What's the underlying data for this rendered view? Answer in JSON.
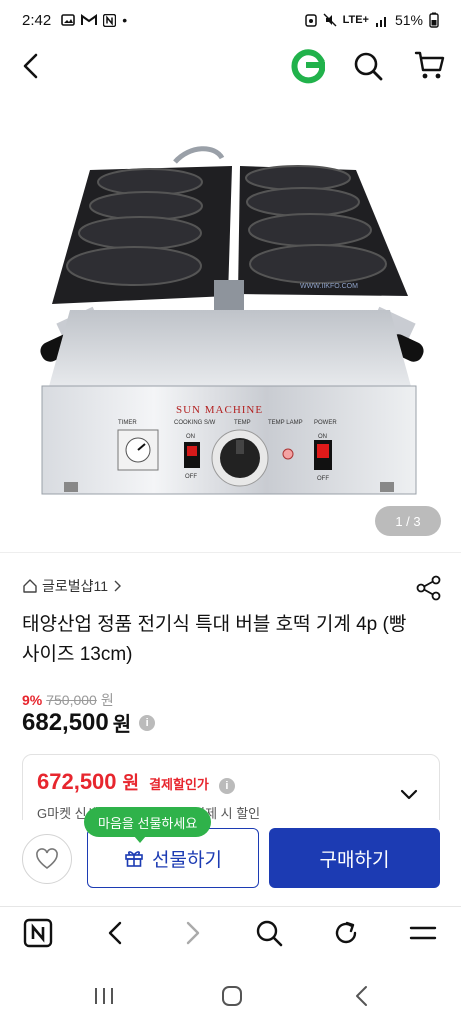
{
  "status_bar": {
    "time": "2:42",
    "network": "LTE+",
    "battery": "51%"
  },
  "header": {
    "icons": [
      "back-icon",
      "g-logo-icon",
      "search-icon",
      "cart-icon"
    ],
    "brand_color": "#21b24b"
  },
  "gallery": {
    "indicator": "1 / 3",
    "machine_brand": "SUN  MACHINE",
    "panel_labels": {
      "timer": "TIMER",
      "cooking": "COOKING S/W",
      "temp": "TEMP",
      "temp_lamp": "TEMP LAMP",
      "power": "POWER",
      "on": "ON",
      "off": "OFF"
    },
    "watermark": "WWW.IIKFO.COM"
  },
  "product": {
    "seller": "글로벌샵11",
    "title": "태양산업 정품 전기식 특대 버블 호떡 기계 4p (빵사이즈 13cm)",
    "discount_rate": "9%",
    "original_price": "750,000",
    "original_unit": "원",
    "price": "682,500",
    "price_unit": "원",
    "info_glyph": "i"
  },
  "coupon": {
    "amount": "672,500",
    "unit": "원",
    "label": "결제할인가",
    "info_glyph": "i",
    "sub": "G마켓 신세계 유니버스 회원 결제 시 할인"
  },
  "actions": {
    "gift_tooltip": "마음을 선물하세요",
    "gift_label": "선물하기",
    "buy_label": "구매하기",
    "accent_color": "#1c3bb3",
    "tooltip_color": "#2fb24a"
  },
  "browser": {
    "icons": [
      "naver-n-icon",
      "browser-back-icon",
      "browser-forward-icon",
      "browser-search-icon",
      "refresh-icon",
      "menu-icon"
    ]
  },
  "system_nav": {
    "icons": [
      "recents-icon",
      "home-icon",
      "back-icon"
    ]
  }
}
